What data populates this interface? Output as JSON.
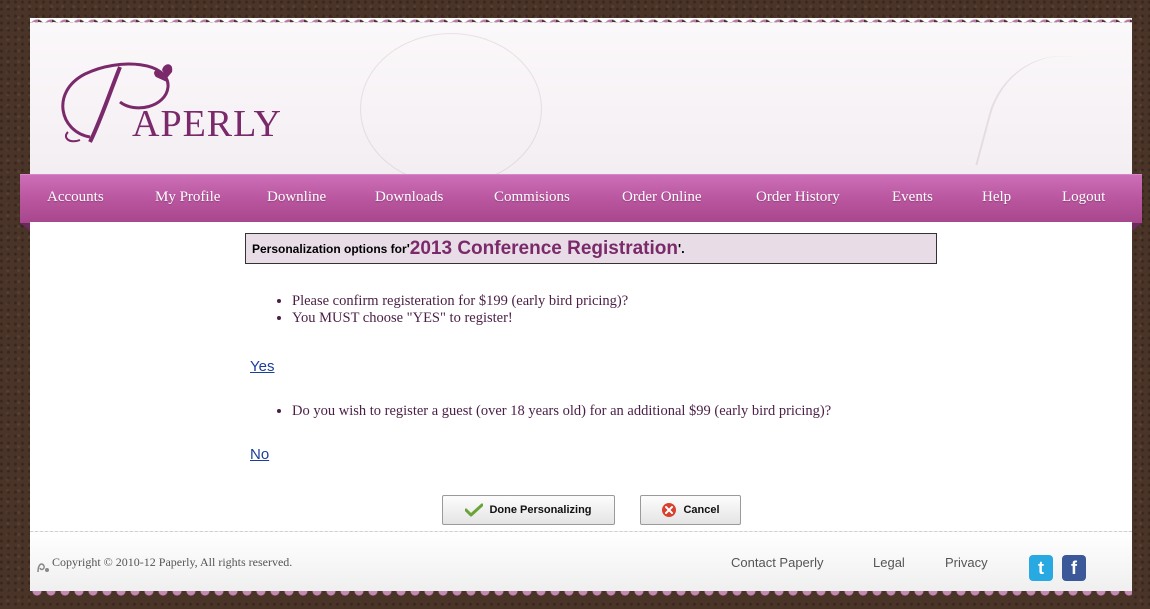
{
  "brand": {
    "logo_text": "APERLY"
  },
  "nav": {
    "items": [
      {
        "label": "Accounts"
      },
      {
        "label": "My Profile"
      },
      {
        "label": "Downline"
      },
      {
        "label": "Downloads"
      },
      {
        "label": "Commisions"
      },
      {
        "label": "Order Online"
      },
      {
        "label": "Order History"
      },
      {
        "label": "Events"
      },
      {
        "label": "Help"
      },
      {
        "label": "Logout"
      }
    ]
  },
  "personalization": {
    "prefix": "Personalization options for ",
    "quote_open": "'",
    "product_name": "2013 Conference Registration",
    "quote_close": "'."
  },
  "questions": {
    "q1_lines": [
      "Please confirm registeration for $199 (early bird pricing)?",
      "You MUST choose \"YES\" to register!"
    ],
    "q1_answer": "Yes",
    "q2_lines": [
      "Do you wish to register a guest (over 18 years old) for an additional $99 (early bird pricing)?"
    ],
    "q2_answer": "No"
  },
  "buttons": {
    "done_label": "Done Personalizing",
    "cancel_label": "Cancel"
  },
  "footer": {
    "copyright": "Copyright © 2010-12 Paperly, All rights reserved.",
    "links": [
      "Contact Paperly",
      "Legal",
      "Privacy"
    ],
    "twitter_glyph": "t",
    "facebook_glyph": "f"
  },
  "colors": {
    "nav_bg": "#b9569f",
    "brand_purple": "#7a2a6a",
    "title_box_bg": "#e8dde7",
    "link_blue": "#1b3e9a",
    "twitter_blue": "#29a9e1",
    "facebook_blue": "#3b5998"
  }
}
